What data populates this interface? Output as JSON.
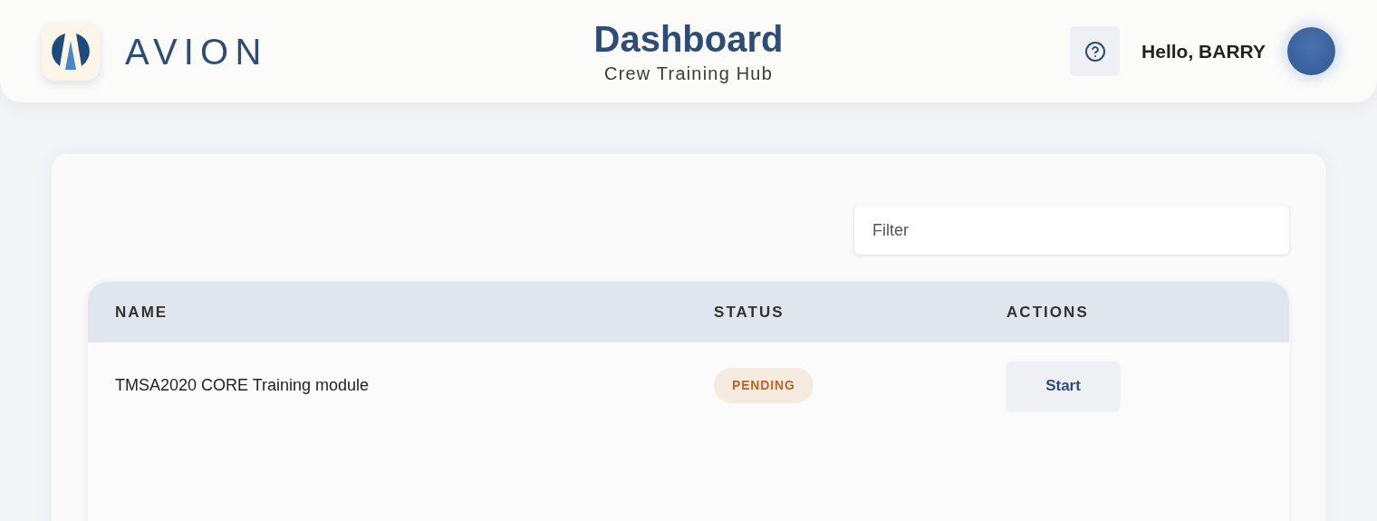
{
  "header": {
    "brand": "AVION",
    "title": "Dashboard",
    "subtitle": "Crew Training Hub",
    "greeting": "Hello, BARRY"
  },
  "filter": {
    "placeholder": "Filter"
  },
  "table": {
    "columns": [
      "NAME",
      "STATUS",
      "ACTIONS"
    ],
    "rows": [
      {
        "name": "TMSA2020 CORE Training module",
        "status": {
          "kind": "pending",
          "label": "PENDING"
        },
        "action": "Start"
      }
    ]
  }
}
